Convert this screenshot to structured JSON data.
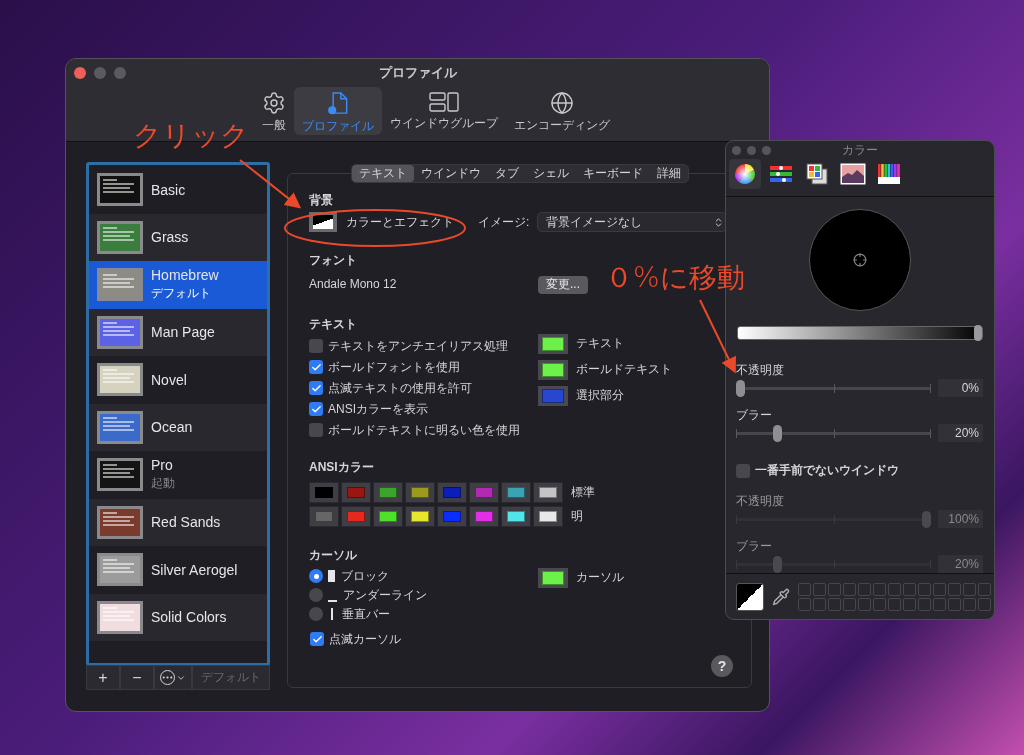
{
  "main_window": {
    "title": "プロファイル",
    "toolbar": [
      {
        "kind": "gear",
        "label": "一般",
        "selected": false
      },
      {
        "kind": "profile",
        "label": "プロファイル",
        "selected": true
      },
      {
        "kind": "windows",
        "label": "ウインドウグループ",
        "selected": false
      },
      {
        "kind": "globe",
        "label": "エンコーディング",
        "selected": false
      }
    ],
    "profiles": [
      {
        "name": "Basic",
        "selected": false,
        "color": "#111111"
      },
      {
        "name": "Grass",
        "selected": false,
        "color": "#3b7d3f"
      },
      {
        "name": "Homebrew",
        "note": "デフォルト",
        "selected": true,
        "color": "#8c8c84"
      },
      {
        "name": "Man Page",
        "selected": false,
        "color": "#5c62e6"
      },
      {
        "name": "Novel",
        "selected": false,
        "color": "#d6d2c0"
      },
      {
        "name": "Ocean",
        "selected": false,
        "color": "#3c6ac8"
      },
      {
        "name": "Pro",
        "note": "起動",
        "selected": false,
        "color": "#141414"
      },
      {
        "name": "Red Sands",
        "selected": false,
        "color": "#7a3a2c"
      },
      {
        "name": "Silver Aerogel",
        "selected": false,
        "color": "#9b9b9b"
      },
      {
        "name": "Solid Colors",
        "selected": false,
        "color": "#f0dde0"
      }
    ],
    "list_buttons": [
      {
        "kind": "text",
        "label": "+",
        "disabled": false
      },
      {
        "kind": "text",
        "label": "−",
        "disabled": false
      },
      {
        "kind": "more",
        "disabled": false
      },
      {
        "kind": "text",
        "label": "デフォルト",
        "disabled": true
      }
    ],
    "tabs": [
      {
        "label": "テキスト",
        "selected": true
      },
      {
        "label": "ウインドウ",
        "selected": false
      },
      {
        "label": "タブ",
        "selected": false
      },
      {
        "label": "シェル",
        "selected": false
      },
      {
        "label": "キーボード",
        "selected": false
      },
      {
        "label": "詳細",
        "selected": false
      }
    ],
    "background": {
      "heading": "背景",
      "button": "カラーとエフェクト",
      "image_label": "イメージ:",
      "image_value": "背景イメージなし"
    },
    "font": {
      "heading": "フォント",
      "value": "Andale Mono 12",
      "button": "変更..."
    },
    "text": {
      "heading": "テキスト",
      "options": [
        {
          "label": "テキストをアンチエイリアス処理",
          "checked": false
        },
        {
          "label": "ボールドフォントを使用",
          "checked": true
        },
        {
          "label": "点滅テキストの使用を許可",
          "checked": true
        },
        {
          "label": "ANSIカラーを表示",
          "checked": true
        },
        {
          "label": "ボールドテキストに明るい色を使用",
          "checked": false
        }
      ],
      "wells": [
        {
          "label": "テキスト",
          "color": "#6ef04a"
        },
        {
          "label": "ボールドテキスト",
          "color": "#6ef04a"
        },
        {
          "label": "選択部分",
          "color": "#2946d0"
        }
      ]
    },
    "ansi": {
      "heading": "ANSIカラー",
      "rows": [
        {
          "label": "標準",
          "colors": [
            {
              "color": "#000000"
            },
            {
              "color": "#991611"
            },
            {
              "color": "#3aa52a"
            },
            {
              "color": "#9c9a1e"
            },
            {
              "color": "#0a1fb8"
            },
            {
              "color": "#b12ab4"
            },
            {
              "color": "#3aa3b3"
            },
            {
              "color": "#c4c4c4"
            }
          ]
        },
        {
          "label": "明",
          "colors": [
            {
              "color": "#666666"
            },
            {
              "color": "#e5291e"
            },
            {
              "color": "#4fe12a"
            },
            {
              "color": "#e6e62c"
            },
            {
              "color": "#0a2eff"
            },
            {
              "color": "#e22ee4"
            },
            {
              "color": "#50e5e8"
            },
            {
              "color": "#e8e8e8"
            }
          ]
        }
      ]
    },
    "cursor": {
      "heading": "カーソル",
      "styles": [
        {
          "kind": "block",
          "label": "ブロック",
          "selected": true
        },
        {
          "kind": "underline",
          "label": "アンダーライン",
          "selected": false
        },
        {
          "kind": "bar",
          "label": "垂直バー",
          "selected": false
        }
      ],
      "well": {
        "label": "カーソル",
        "color": "#6ef04a"
      },
      "blink": {
        "label": "点滅カーソル",
        "checked": true
      }
    },
    "help": "?"
  },
  "color_panel": {
    "title": "カラー",
    "modes": [
      {
        "kind": "wheel",
        "selected": true
      },
      {
        "kind": "sliders",
        "selected": false
      },
      {
        "kind": "palettes",
        "selected": false
      },
      {
        "kind": "image",
        "selected": false
      },
      {
        "kind": "pencils",
        "selected": false
      }
    ],
    "brightness": {
      "level": 1
    },
    "front": [
      {
        "label": "不透明度",
        "level": 0,
        "value": "0%"
      },
      {
        "label": "ブラー",
        "level": 0.2,
        "value": "20%"
      }
    ],
    "inactive_option": {
      "label": "一番手前でないウインドウ",
      "checked": false
    },
    "inactive": [
      {
        "label": "不透明度",
        "level": 1,
        "value": "100%"
      },
      {
        "label": "ブラー",
        "level": 0.2,
        "value": "20%"
      }
    ]
  },
  "annotations": [
    {
      "kind": "click",
      "text": "クリック"
    },
    {
      "kind": "move",
      "text": "０%に移動"
    }
  ]
}
